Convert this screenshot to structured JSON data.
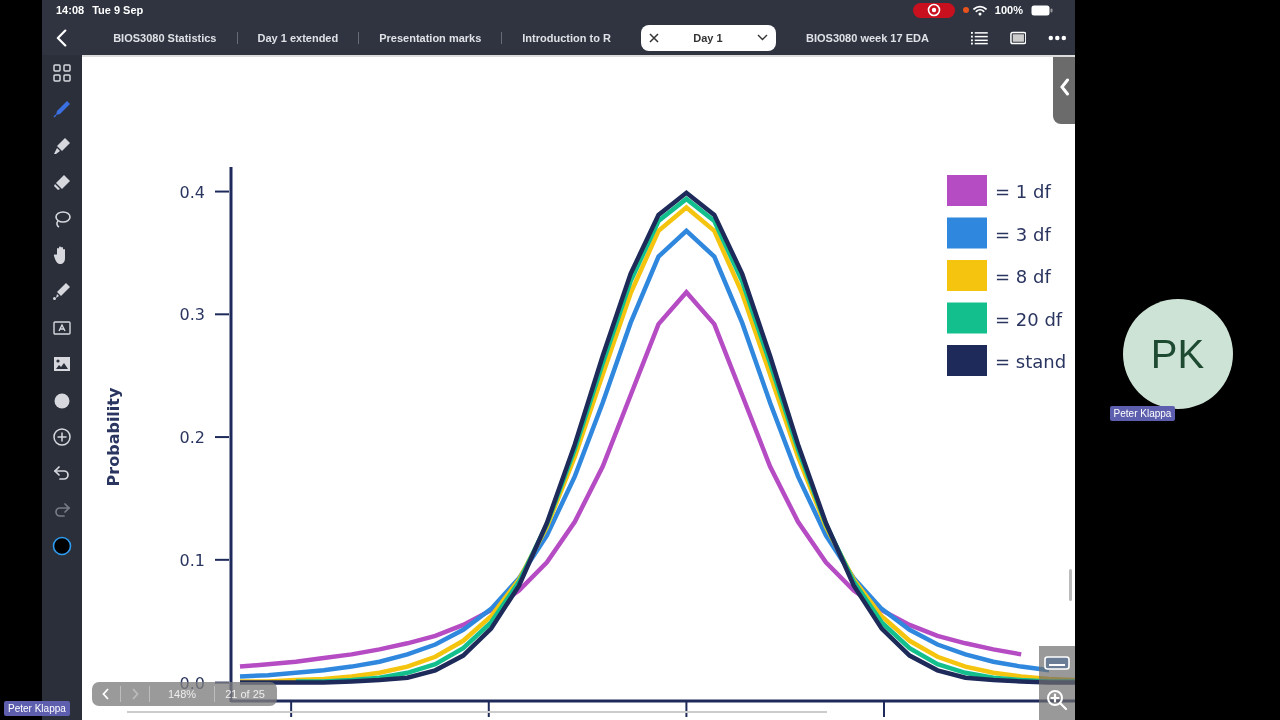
{
  "status_bar": {
    "time": "14:08",
    "date": "Tue 9 Sep",
    "battery": "100%",
    "recording": true
  },
  "tabs": [
    {
      "label": "BIOS3080 Statistics",
      "selected": false
    },
    {
      "label": "Day 1 extended",
      "selected": false
    },
    {
      "label": "Presentation marks",
      "selected": false
    },
    {
      "label": "Introduction to R",
      "selected": false
    },
    {
      "label": "Day 1",
      "selected": true
    },
    {
      "label": "BIOS3080 week 17 EDA",
      "selected": false
    }
  ],
  "tools": [
    {
      "kind": "grid",
      "selected": false,
      "disabled": false
    },
    {
      "kind": "pen",
      "selected": true,
      "disabled": false
    },
    {
      "kind": "highlighter",
      "selected": false,
      "disabled": false
    },
    {
      "kind": "eraser",
      "selected": false,
      "disabled": false
    },
    {
      "kind": "lasso",
      "selected": false,
      "disabled": false
    },
    {
      "kind": "hand",
      "selected": false,
      "disabled": false
    },
    {
      "kind": "laser",
      "selected": false,
      "disabled": false
    },
    {
      "kind": "textbox",
      "selected": false,
      "disabled": false
    },
    {
      "kind": "image",
      "selected": false,
      "disabled": false
    },
    {
      "kind": "shape",
      "selected": false,
      "disabled": false
    },
    {
      "kind": "add",
      "selected": false,
      "disabled": false
    },
    {
      "kind": "undo",
      "selected": false,
      "disabled": false
    },
    {
      "kind": "redo",
      "selected": false,
      "disabled": true
    },
    {
      "kind": "color",
      "selected": false,
      "disabled": false
    }
  ],
  "slide": {
    "chart_data": {
      "type": "line",
      "ylabel": "Probability",
      "categories": [
        null,
        null,
        null,
        null,
        null,
        null,
        null,
        null,
        null,
        null,
        null,
        null,
        null,
        null,
        null,
        null,
        null,
        null,
        null,
        null,
        null,
        null,
        null,
        null,
        null,
        null,
        null,
        null,
        null,
        null,
        null
      ],
      "ylim": [
        -0.015,
        0.42
      ],
      "legend": "top-right",
      "yticks": [
        {
          "value": 0,
          "label": "0.0"
        },
        {
          "value": 0.1,
          "label": "0.1"
        },
        {
          "value": 0.2,
          "label": "0.2"
        },
        {
          "value": 0.3,
          "label": "0.3"
        },
        {
          "value": 0.4,
          "label": "0.4"
        }
      ],
      "series": [
        {
          "name": "= 1 df",
          "color": "#b64cc4",
          "values": [
            0.013,
            0.015,
            0.017,
            0.02,
            0.023,
            0.027,
            0.032,
            0.038,
            0.047,
            0.059,
            0.075,
            0.098,
            0.131,
            0.176,
            0.234,
            0.292,
            0.318,
            0.292,
            0.234,
            0.176,
            0.131,
            0.098,
            0.075,
            0.059,
            0.047,
            0.038,
            0.032,
            0.027,
            0.023,
            null,
            null
          ]
        },
        {
          "name": "= 3 df",
          "color": "#2f88de",
          "values": [
            0.005,
            0.006,
            0.008,
            0.01,
            0.013,
            0.017,
            0.023,
            0.031,
            0.043,
            0.06,
            0.085,
            0.12,
            0.168,
            0.228,
            0.293,
            0.347,
            0.368,
            0.347,
            0.293,
            0.228,
            0.168,
            0.12,
            0.085,
            0.06,
            0.043,
            0.031,
            0.023,
            0.017,
            0.013,
            0.01,
            null
          ]
        },
        {
          "name": "= 8 df",
          "color": "#f4c40f",
          "values": [
            0.001,
            0.001,
            0.002,
            0.003,
            0.005,
            0.008,
            0.013,
            0.021,
            0.034,
            0.054,
            0.084,
            0.127,
            0.184,
            0.251,
            0.317,
            0.368,
            0.387,
            0.368,
            0.317,
            0.251,
            0.184,
            0.127,
            0.084,
            0.054,
            0.034,
            0.021,
            0.013,
            0.008,
            0.005,
            0.003,
            0.002
          ]
        },
        {
          "name": "= 20 df",
          "color": "#14bf8e",
          "values": [
            null,
            null,
            0.001,
            0.001,
            0.002,
            0.004,
            0.008,
            0.015,
            0.028,
            0.049,
            0.082,
            0.129,
            0.19,
            0.26,
            0.327,
            0.376,
            0.394,
            0.376,
            0.327,
            0.26,
            0.19,
            0.129,
            0.082,
            0.049,
            0.028,
            0.015,
            0.008,
            0.004,
            0.002,
            0.001,
            0.001
          ]
        },
        {
          "name": "= stand",
          "color": "#1e2a5a",
          "values": [
            0,
            0,
            0,
            0,
            0.001,
            0.002,
            0.004,
            0.01,
            0.022,
            0.044,
            0.079,
            0.13,
            0.194,
            0.266,
            0.333,
            0.381,
            0.399,
            0.381,
            0.333,
            0.266,
            0.194,
            0.13,
            0.079,
            0.044,
            0.022,
            0.01,
            0.004,
            0.002,
            0.001,
            0,
            0
          ]
        }
      ]
    }
  },
  "page_nav": {
    "zoom": "148%",
    "page": "21 of 25"
  },
  "participant": {
    "initials": "PK",
    "name": "Peter Klappa"
  },
  "self_view": {
    "name": "Peter Klappa"
  }
}
